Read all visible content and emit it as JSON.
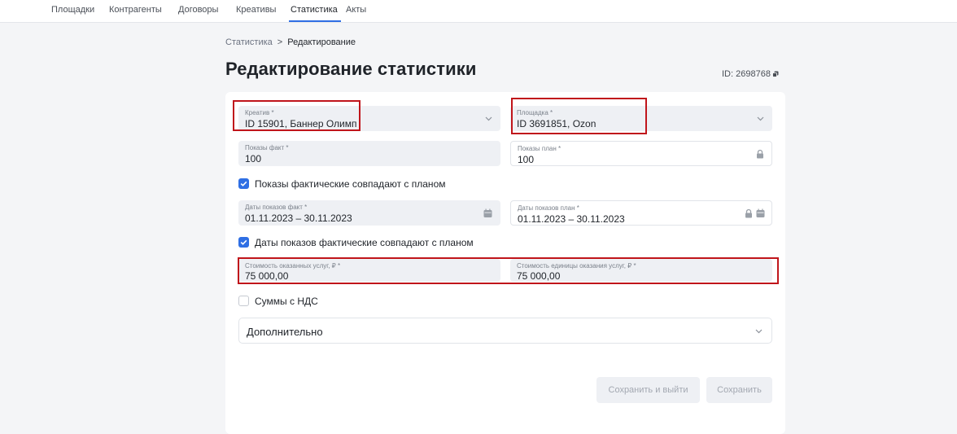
{
  "nav": {
    "items": [
      {
        "label": "Площадки"
      },
      {
        "label": "Контрагенты"
      },
      {
        "label": "Договоры"
      },
      {
        "label": "Креативы"
      },
      {
        "label": "Статистика",
        "active": true
      },
      {
        "label": "Акты"
      }
    ],
    "accent": "#2f6fe4"
  },
  "breadcrumb": {
    "parent": "Статистика",
    "separator": ">",
    "current": "Редактирование"
  },
  "page": {
    "title": "Редактирование статистики",
    "id_label": "ID: 2698768"
  },
  "form": {
    "creative": {
      "label": "Креатив *",
      "value": "ID 15901, Баннер Олимп"
    },
    "platform": {
      "label": "Площадка *",
      "value": "ID 3691851, Ozon"
    },
    "impressions_fact": {
      "label": "Показы факт *",
      "value": "100"
    },
    "impressions_plan": {
      "label": "Показы план *",
      "value": "100"
    },
    "impressions_match": {
      "label": "Показы фактические совпадают с планом",
      "checked": true
    },
    "dates_fact": {
      "label": "Даты показов факт *",
      "value": "01.11.2023 – 30.11.2023"
    },
    "dates_plan": {
      "label": "Даты показов план *",
      "value": "01.11.2023 – 30.11.2023"
    },
    "dates_match": {
      "label": "Даты показов фактические совпадают с планом",
      "checked": true
    },
    "cost_services": {
      "label": "Стоимость оказанных услуг, ₽ *",
      "value": "75 000,00"
    },
    "cost_unit": {
      "label": "Стоимость единицы оказания услуг, ₽ *",
      "value": "75 000,00"
    },
    "vat": {
      "label": "Суммы с НДС",
      "checked": false
    },
    "additional": {
      "label": "Дополнительно"
    }
  },
  "actions": {
    "save_exit": "Сохранить и выйти",
    "save": "Сохранить"
  },
  "colors": {
    "highlight": "#c0151b",
    "field_bg": "#eef0f4",
    "checkbox": "#2f6fe4"
  }
}
